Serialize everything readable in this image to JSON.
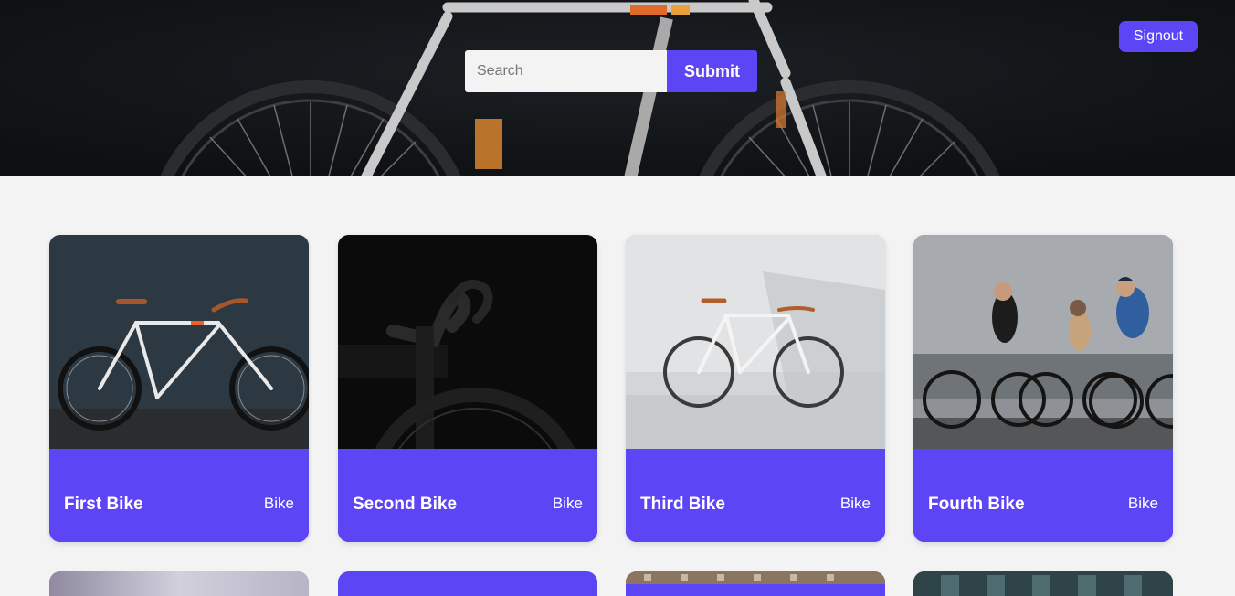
{
  "header": {
    "search_placeholder": "Search",
    "submit_label": "Submit",
    "signout_label": "Signout"
  },
  "colors": {
    "accent": "#5b45f5",
    "page_bg": "#f3f3f3",
    "hero_bg": "#111417"
  },
  "cards": [
    {
      "name": "First Bike",
      "type": "Bike"
    },
    {
      "name": "Second Bike",
      "type": "Bike"
    },
    {
      "name": "Third Bike",
      "type": "Bike"
    },
    {
      "name": "Fourth Bike",
      "type": "Bike"
    }
  ]
}
